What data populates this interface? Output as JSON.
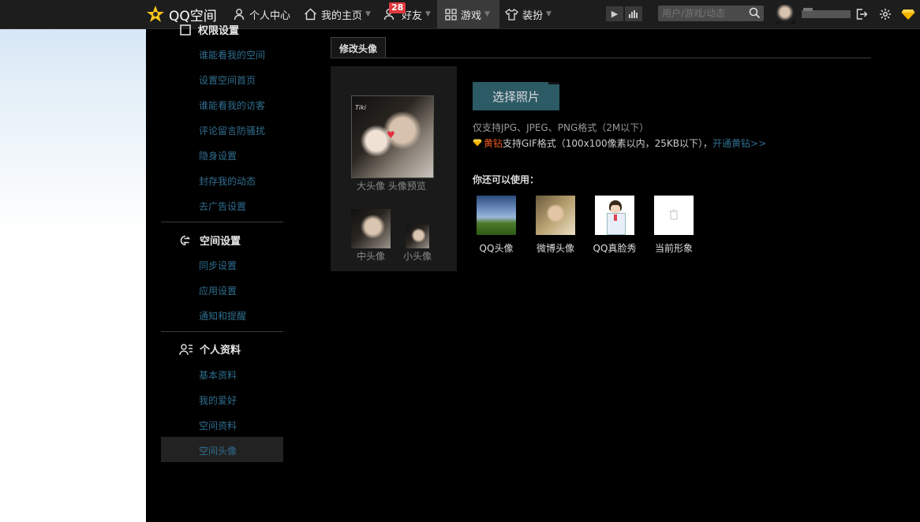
{
  "topbar": {
    "logo": "QQ空间",
    "nav": [
      {
        "label": "个人中心"
      },
      {
        "label": "我的主页"
      },
      {
        "label": "好友",
        "badge": "28"
      },
      {
        "label": "游戏"
      },
      {
        "label": "装扮"
      }
    ],
    "search_placeholder": "用户/游戏/动态"
  },
  "sidebar": {
    "section_privacy": {
      "title": "权限设置",
      "items": [
        "谁能看我的空间",
        "设置空间首页",
        "谁能看我的访客",
        "评论留言防骚扰",
        "隐身设置",
        "封存我的动态",
        "去广告设置"
      ]
    },
    "section_space": {
      "title": "空间设置",
      "items": [
        "同步设置",
        "应用设置",
        "通知和提醒"
      ]
    },
    "section_profile": {
      "title": "个人资料",
      "items": [
        "基本资料",
        "我的爱好",
        "空间资料",
        "空间头像"
      ]
    }
  },
  "main": {
    "tab": "修改头像",
    "large_caption": "大头像 头像预览",
    "medium_caption": "中头像",
    "small_caption": "小头像",
    "avatar_tag": "Tiki",
    "choose_button": "选择照片",
    "hint_formats": "仅支持JPG、JPEG、PNG格式（2M以下）",
    "hint_yellow": "黄钻",
    "hint_gif": "支持GIF格式（100x100像素以内，25KB以下），",
    "hint_link": "开通黄钻>>",
    "also_title": "你还可以使用：",
    "options": [
      "QQ头像",
      "微博头像",
      "QQ真脸秀",
      "当前形象"
    ]
  },
  "colors": {
    "accent": "#2f6e8f",
    "button": "#2c5a65",
    "yellow_diamond": "#f05a1d",
    "badge": "#e0383e"
  }
}
